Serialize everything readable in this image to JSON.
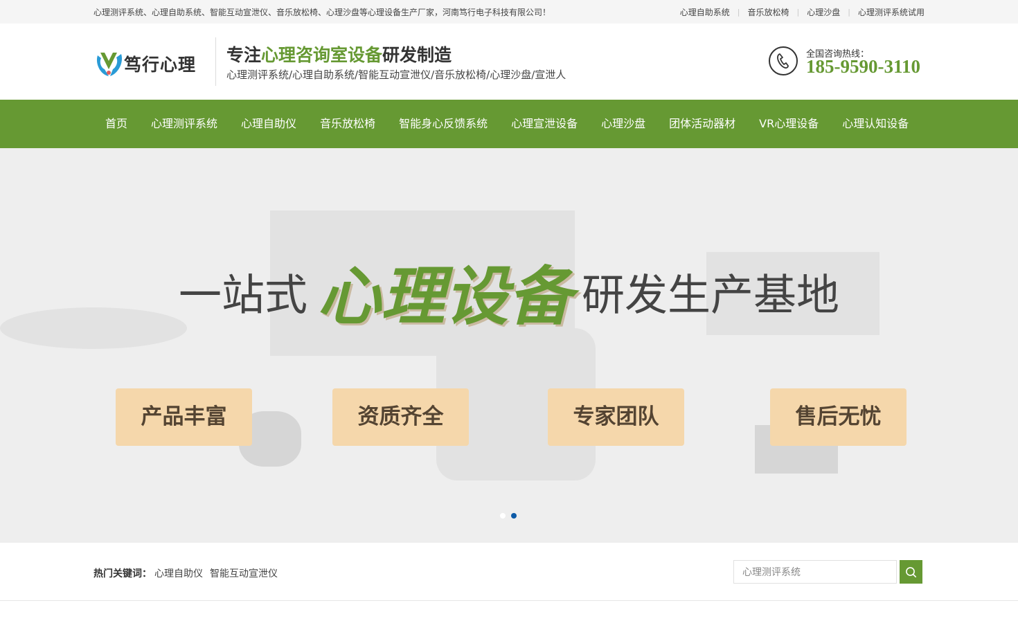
{
  "topbar": {
    "intro": "心理测评系统、心理自助系统、智能互动宣泄仪、音乐放松椅、心理沙盘等心理设备生产厂家，河南笃行电子科技有限公司！",
    "links": [
      "心理自助系统",
      "音乐放松椅",
      "心理沙盘",
      "心理测评系统试用"
    ],
    "separator": "|"
  },
  "header": {
    "logo_text": "笃行心理",
    "slogan_pre": "专注",
    "slogan_highlight": "心理咨询室设备",
    "slogan_post": "研发制造",
    "sub_slogan": "心理测评系统/心理自助系统/智能互动宣泄仪/音乐放松椅/心理沙盘/宣泄人",
    "hotline_label": "全国咨询热线：",
    "hotline_number": "185-9590-3110",
    "phone_icon": "phone-icon"
  },
  "nav": {
    "items": [
      "首页",
      "心理测评系统",
      "心理自助仪",
      "音乐放松椅",
      "智能身心反馈系统",
      "心理宣泄设备",
      "心理沙盘",
      "团体活动器材",
      "VR心理设备",
      "心理认知设备"
    ]
  },
  "banner": {
    "title_pre": "一站式",
    "title_highlight": "心理设备",
    "title_post": "研发生产基地",
    "features": [
      "产品丰富",
      "资质齐全",
      "专家团队",
      "售后无忧"
    ],
    "slide_count": 2,
    "active_slide": 2
  },
  "keywords": {
    "label": "热门关键词：",
    "items": [
      "心理自助仪",
      "智能互动宣泄仪"
    ]
  },
  "search": {
    "placeholder": "心理测评系统",
    "icon": "search-icon"
  },
  "colors": {
    "brand_green": "#669933",
    "feature_box": "#f5d7ab",
    "dot_active": "#0d5aa7"
  }
}
